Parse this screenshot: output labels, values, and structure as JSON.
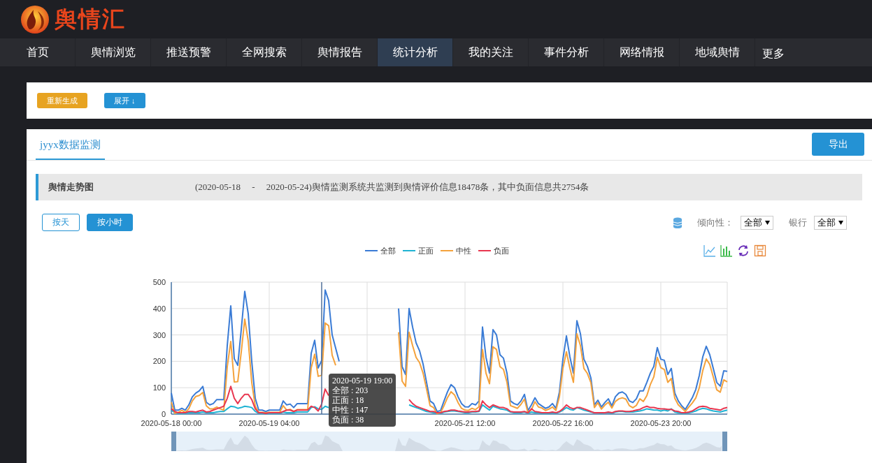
{
  "header": {
    "logo_text": "舆情汇"
  },
  "nav": {
    "items": [
      {
        "label": "首页",
        "selected": false
      },
      {
        "label": "舆情浏览",
        "selected": false
      },
      {
        "label": "推送预警",
        "selected": false
      },
      {
        "label": "全网搜索",
        "selected": false
      },
      {
        "label": "舆情报告",
        "selected": false
      },
      {
        "label": "统计分析",
        "selected": true
      },
      {
        "label": "我的关注",
        "selected": false
      },
      {
        "label": "事件分析",
        "selected": false
      },
      {
        "label": "网络情报",
        "selected": false
      },
      {
        "label": "地域舆情",
        "selected": false
      }
    ],
    "more": "更多"
  },
  "actions": [
    {
      "label": "重新生成",
      "kind": "warning"
    },
    {
      "label": "展开 ↓",
      "kind": "primary"
    }
  ],
  "panel": {
    "tab": {
      "label": "jyyx数据监测",
      "selected": true
    },
    "export_button": "导出",
    "section": {
      "title": "舆情走势图",
      "summary": "(2020-05-18     -     2020-05-24)舆情监测系统共监测到舆情评价信息18478条，其中负面信息共2754条"
    },
    "granularity": [
      {
        "label": "按天",
        "selected": false
      },
      {
        "label": "按小时",
        "selected": true
      }
    ],
    "filters": [
      {
        "label": "倾向性：",
        "value": "全部"
      },
      {
        "label": "银行",
        "value": "全部"
      }
    ],
    "chart": {
      "chart_data": {
        "type": "line",
        "categories": [
          "2020-05-18 00:00",
          null,
          null,
          null,
          null,
          null,
          null,
          null,
          null,
          null,
          null,
          null,
          null,
          null,
          null,
          null,
          null,
          null,
          null,
          null,
          null,
          null,
          null,
          null,
          null,
          null,
          null,
          null,
          "2020-05-19 04:00",
          null,
          null,
          null,
          null,
          null,
          null,
          null,
          null,
          null,
          null,
          null,
          null,
          null,
          null,
          null,
          null,
          null,
          null,
          null,
          null,
          null,
          null,
          null,
          null,
          null,
          null,
          null,
          null,
          null,
          null,
          null,
          null,
          null,
          null,
          null,
          null,
          null,
          null,
          null,
          null,
          null,
          null,
          null,
          null,
          null,
          null,
          null,
          null,
          null,
          null,
          null,
          null,
          null,
          null,
          null,
          "2020-05-21 12:00",
          null,
          null,
          null,
          null,
          null,
          null,
          null,
          null,
          null,
          null,
          null,
          null,
          null,
          null,
          null,
          null,
          null,
          null,
          null,
          null,
          null,
          null,
          null,
          null,
          null,
          null,
          null,
          "2020-05-22 16:00",
          null,
          null,
          null,
          null,
          null,
          null,
          null,
          null,
          null,
          null,
          null,
          null,
          null,
          null,
          null,
          null,
          null,
          null,
          null,
          null,
          null,
          null,
          null,
          null,
          null,
          null,
          null,
          "2020-05-23 20:00",
          null,
          null,
          null,
          null,
          null,
          null,
          null,
          null,
          null,
          null,
          null,
          null,
          null,
          null,
          null,
          null,
          null,
          null,
          null
        ],
        "series": [
          {
            "name": "全部",
            "color": "#3a7bd5",
            "values": [
              80,
              15,
              15,
              22,
              15,
              35,
              65,
              80,
              88,
              105,
              45,
              35,
              40,
              55,
              55,
              55,
              260,
              410,
              210,
              185,
              320,
              465,
              380,
              200,
              60,
              15,
              15,
              10,
              15,
              15,
              15,
              15,
              50,
              35,
              38,
              25,
              40,
              40,
              40,
              40,
              230,
              280,
              175,
              203,
              470,
              430,
              300,
              250,
              200,
              null,
              null,
              null,
              null,
              null,
              null,
              null,
              null,
              null,
              null,
              null,
              null,
              null,
              null,
              null,
              null,
              400,
              180,
              150,
              400,
              330,
              270,
              240,
              190,
              120,
              50,
              40,
              10,
              13,
              50,
              85,
              112,
              100,
              66,
              40,
              28,
              27,
              40,
              35,
              50,
              330,
              215,
              155,
              320,
              300,
              225,
              212,
              155,
              50,
              40,
              35,
              50,
              75,
              13,
              35,
              62,
              40,
              31,
              22,
              27,
              40,
              22,
              84,
              208,
              296,
              217,
              155,
              354,
              305,
              208,
              181,
              137,
              35,
              53,
              27,
              44,
              58,
              31,
              66,
              80,
              84,
              75,
              50,
              44,
              58,
              88,
              88,
              120,
              155,
              181,
              252,
              208,
              204,
              150,
              173,
              80,
              50,
              31,
              18,
              40,
              62,
              93,
              146,
              217,
              257,
              225,
              173,
              120,
              106,
              164,
              162
            ]
          },
          {
            "name": "正面",
            "color": "#1fb3d3",
            "values": [
              15,
              5,
              3,
              3,
              3,
              5,
              5,
              5,
              5,
              8,
              5,
              5,
              5,
              8,
              10,
              10,
              20,
              30,
              28,
              22,
              25,
              30,
              28,
              25,
              10,
              3,
              3,
              2,
              3,
              3,
              3,
              3,
              8,
              5,
              5,
              5,
              8,
              8,
              8,
              8,
              25,
              28,
              20,
              18,
              30,
              25,
              null,
              null,
              null,
              null,
              null,
              null,
              null,
              null,
              null,
              null,
              null,
              null,
              null,
              null,
              null,
              null,
              null,
              null,
              null,
              null,
              null,
              null,
              35,
              30,
              25,
              20,
              15,
              10,
              8,
              5,
              3,
              3,
              8,
              10,
              12,
              12,
              10,
              8,
              5,
              5,
              8,
              8,
              10,
              35,
              25,
              15,
              30,
              25,
              20,
              18,
              15,
              8,
              5,
              5,
              5,
              8,
              3,
              8,
              5,
              5,
              3,
              3,
              3,
              5,
              3,
              8,
              15,
              25,
              18,
              15,
              25,
              20,
              15,
              12,
              8,
              5,
              5,
              3,
              5,
              5,
              3,
              8,
              10,
              10,
              8,
              8,
              8,
              10,
              12,
              15,
              20,
              18,
              15,
              15,
              12,
              15,
              12,
              20,
              8,
              5,
              3,
              3,
              5,
              8,
              12,
              18,
              22,
              20,
              15,
              12,
              10,
              8,
              12,
              15
            ]
          },
          {
            "name": "中性",
            "color": "#f4a23c",
            "values": [
              45,
              3,
              7,
              14,
              7,
              20,
              50,
              67,
              71,
              82,
              32,
              20,
              20,
              27,
              20,
              15,
              180,
              275,
              122,
              123,
              235,
              360,
              277,
              120,
              30,
              7,
              7,
              5,
              7,
              7,
              7,
              7,
              32,
              15,
              18,
              10,
              17,
              17,
              17,
              17,
              175,
              227,
              143,
              147,
              345,
              335,
              223,
              185,
              null,
              null,
              null,
              null,
              null,
              null,
              null,
              null,
              null,
              null,
              null,
              null,
              null,
              null,
              null,
              null,
              null,
              310,
              125,
              105,
              310,
              260,
              215,
              195,
              155,
              95,
              32,
              25,
              2,
              5,
              32,
              63,
              85,
              73,
              44,
              22,
              15,
              14,
              22,
              17,
              28,
              245,
              155,
              115,
              255,
              245,
              180,
              169,
              120,
              32,
              27,
              22,
              37,
              57,
              5,
              17,
              47,
              27,
              23,
              14,
              19,
              27,
              14,
              66,
              173,
              236,
              174,
              120,
              304,
              260,
              173,
              154,
              119,
              25,
              43,
              19,
              34,
              45,
              23,
              48,
              58,
              62,
              57,
              32,
              24,
              33,
              58,
              48,
              70,
              112,
              141,
              215,
              176,
              169,
              120,
              135,
              60,
              35,
              23,
              10,
              27,
              42,
              61,
              100,
              165,
              209,
              188,
              141,
              92,
              83,
              130,
              122
            ]
          },
          {
            "name": "负面",
            "color": "#e8364f",
            "values": [
              20,
              10,
              5,
              5,
              5,
              10,
              10,
              8,
              12,
              15,
              8,
              10,
              15,
              20,
              25,
              30,
              60,
              105,
              60,
              40,
              60,
              75,
              75,
              55,
              20,
              5,
              5,
              3,
              5,
              5,
              5,
              5,
              10,
              15,
              15,
              10,
              15,
              15,
              15,
              15,
              30,
              25,
              12,
              38,
              95,
              70,
              null,
              null,
              null,
              null,
              null,
              null,
              null,
              null,
              null,
              null,
              null,
              null,
              null,
              null,
              null,
              null,
              null,
              null,
              null,
              null,
              null,
              null,
              55,
              40,
              30,
              25,
              20,
              15,
              10,
              10,
              5,
              5,
              10,
              12,
              15,
              15,
              12,
              10,
              8,
              8,
              10,
              10,
              12,
              50,
              35,
              25,
              35,
              30,
              25,
              25,
              20,
              10,
              8,
              8,
              8,
              10,
              5,
              20,
              10,
              8,
              5,
              5,
              5,
              8,
              5,
              10,
              20,
              35,
              25,
              20,
              25,
              25,
              20,
              15,
              10,
              5,
              5,
              5,
              5,
              8,
              5,
              10,
              12,
              12,
              10,
              10,
              12,
              15,
              18,
              25,
              30,
              25,
              25,
              22,
              20,
              20,
              18,
              18,
              12,
              10,
              5,
              5,
              8,
              12,
              20,
              28,
              30,
              28,
              22,
              20,
              18,
              15,
              22,
              25
            ]
          }
        ],
        "ylim": [
          0,
          500
        ],
        "grid": true,
        "yticks": [
          0,
          100,
          200,
          300,
          400,
          500
        ]
      },
      "tooltip": {
        "title": "2020-05-19 19:00",
        "lines": [
          "全部 : 203",
          "正面 : 18",
          "中性 : 147",
          "负面 : 38"
        ]
      }
    }
  }
}
